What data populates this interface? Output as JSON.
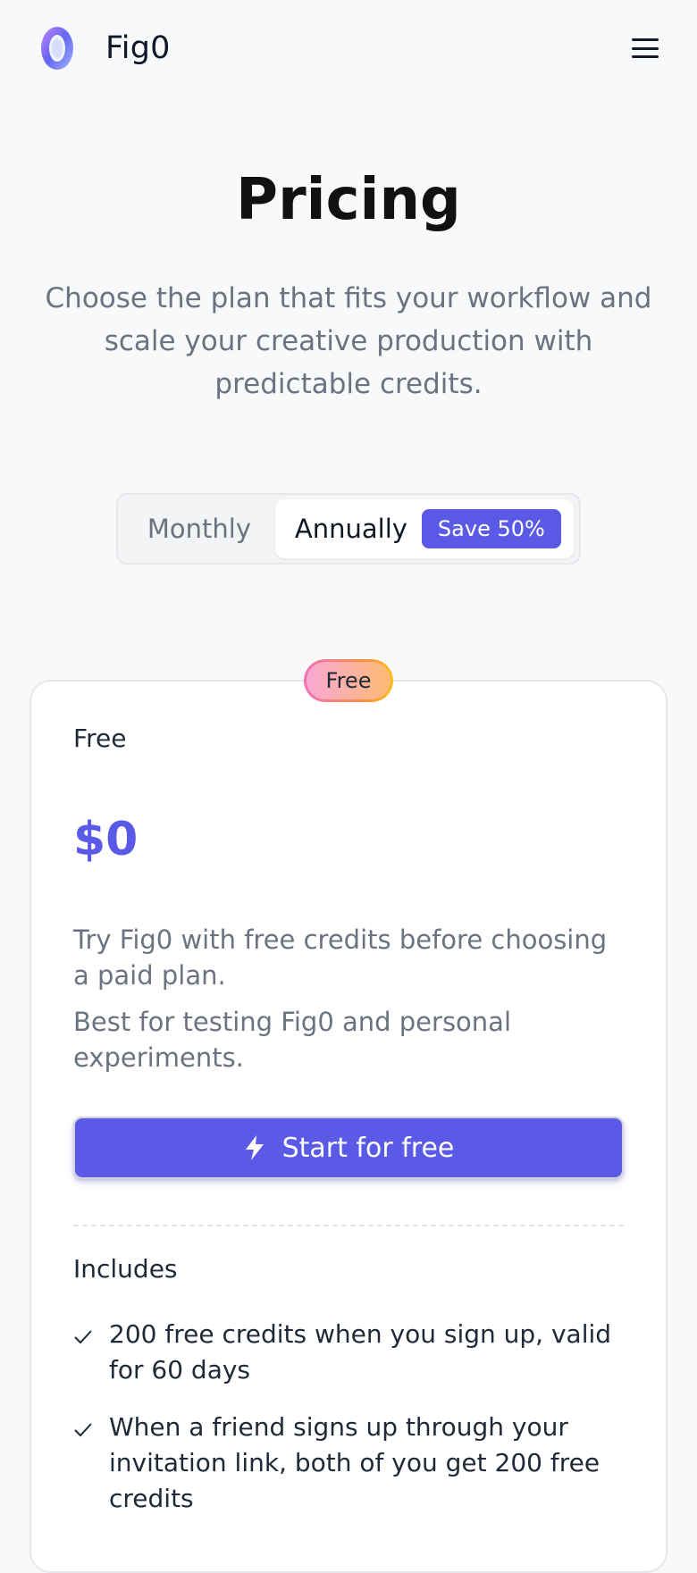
{
  "header": {
    "brand_name": "Fig0",
    "logo_icon": "fig0-logo-icon",
    "menu_icon": "hamburger-menu-icon"
  },
  "hero": {
    "title": "Pricing",
    "subtitle": "Choose the plan that fits your workflow and scale your creative production with predictable credits."
  },
  "billing_toggle": {
    "monthly_label": "Monthly",
    "annually_label": "Annually",
    "save_badge": "Save 50%",
    "selected": "Annually"
  },
  "plan": {
    "ribbon": "Free",
    "name": "Free",
    "price": "$0",
    "description": "Try Fig0 with free credits before choosing a paid plan.",
    "best_for": "Best for testing Fig0 and personal experiments.",
    "cta_label": "Start for free",
    "cta_icon": "lightning-bolt-icon",
    "includes_label": "Includes",
    "features": [
      "200 free credits when you sign up, valid for 60 days",
      "When a friend signs up through your invitation link, both of you get 200 free credits"
    ]
  },
  "colors": {
    "accent": "#5a5ae6",
    "background": "#f8f9fb",
    "muted_text": "#6b7280"
  }
}
